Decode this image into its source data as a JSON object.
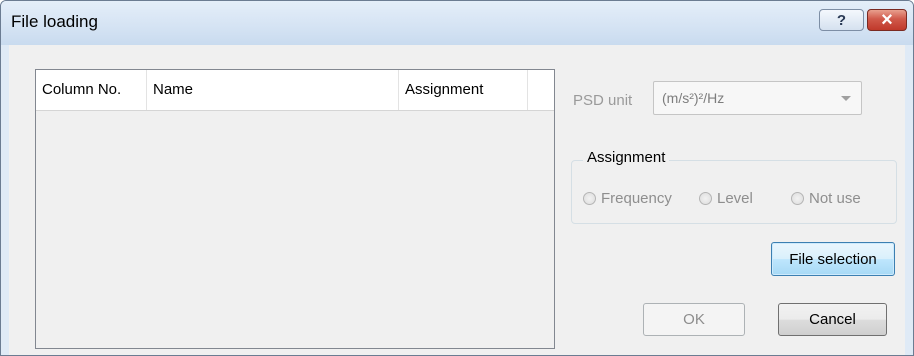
{
  "window": {
    "title": "File loading",
    "help_label": "?",
    "close_label": "×"
  },
  "list": {
    "columns": [
      "Column No.",
      "Name",
      "Assignment",
      ""
    ]
  },
  "psd": {
    "label": "PSD unit",
    "selected": "(m/s²)²/Hz"
  },
  "assignment": {
    "legend": "Assignment",
    "options": [
      "Frequency",
      "Level",
      "Not use"
    ]
  },
  "buttons": {
    "file_selection": "File selection",
    "ok": "OK",
    "cancel": "Cancel"
  },
  "colors": {
    "titlebar": "#d6e4f4",
    "close_button": "#c0392b",
    "default_button_border": "#3c7fb1",
    "disabled_text": "#8d8d8d"
  },
  "icons": {
    "help": "question-mark-icon",
    "close": "close-icon",
    "dropdown": "chevron-down-icon"
  }
}
